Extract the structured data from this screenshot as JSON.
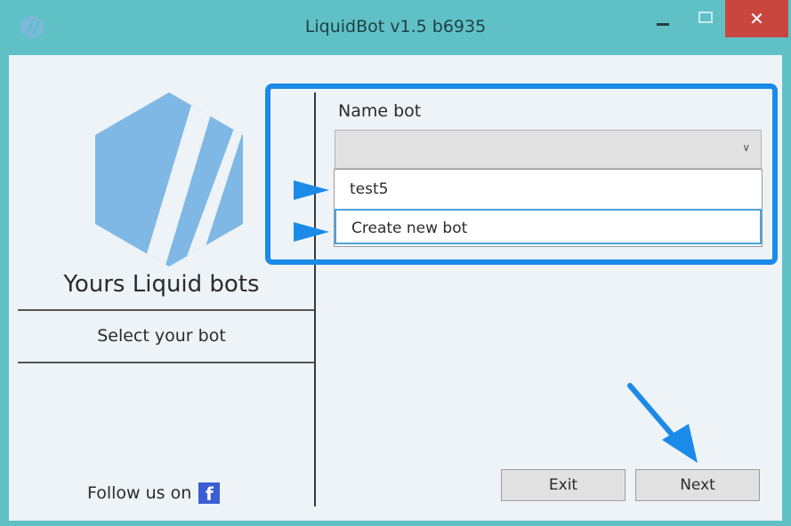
{
  "window": {
    "title": "LiquidBot v1.5 b6935",
    "close_glyph": "✕",
    "icons": [
      "app-logo-icon",
      "minimize-icon",
      "maximize-icon",
      "close-icon"
    ]
  },
  "sidebar": {
    "brand": "Yours Liquid bots",
    "step_label": "Select your bot",
    "follow_text": "Follow us on",
    "facebook_glyph": "f"
  },
  "main": {
    "name_label": "Name bot",
    "combo_value": "",
    "options": [
      "test5",
      "Create new bot"
    ],
    "highlight_color": "#1b8ae8"
  },
  "buttons": {
    "exit": "Exit",
    "next": "Next"
  }
}
